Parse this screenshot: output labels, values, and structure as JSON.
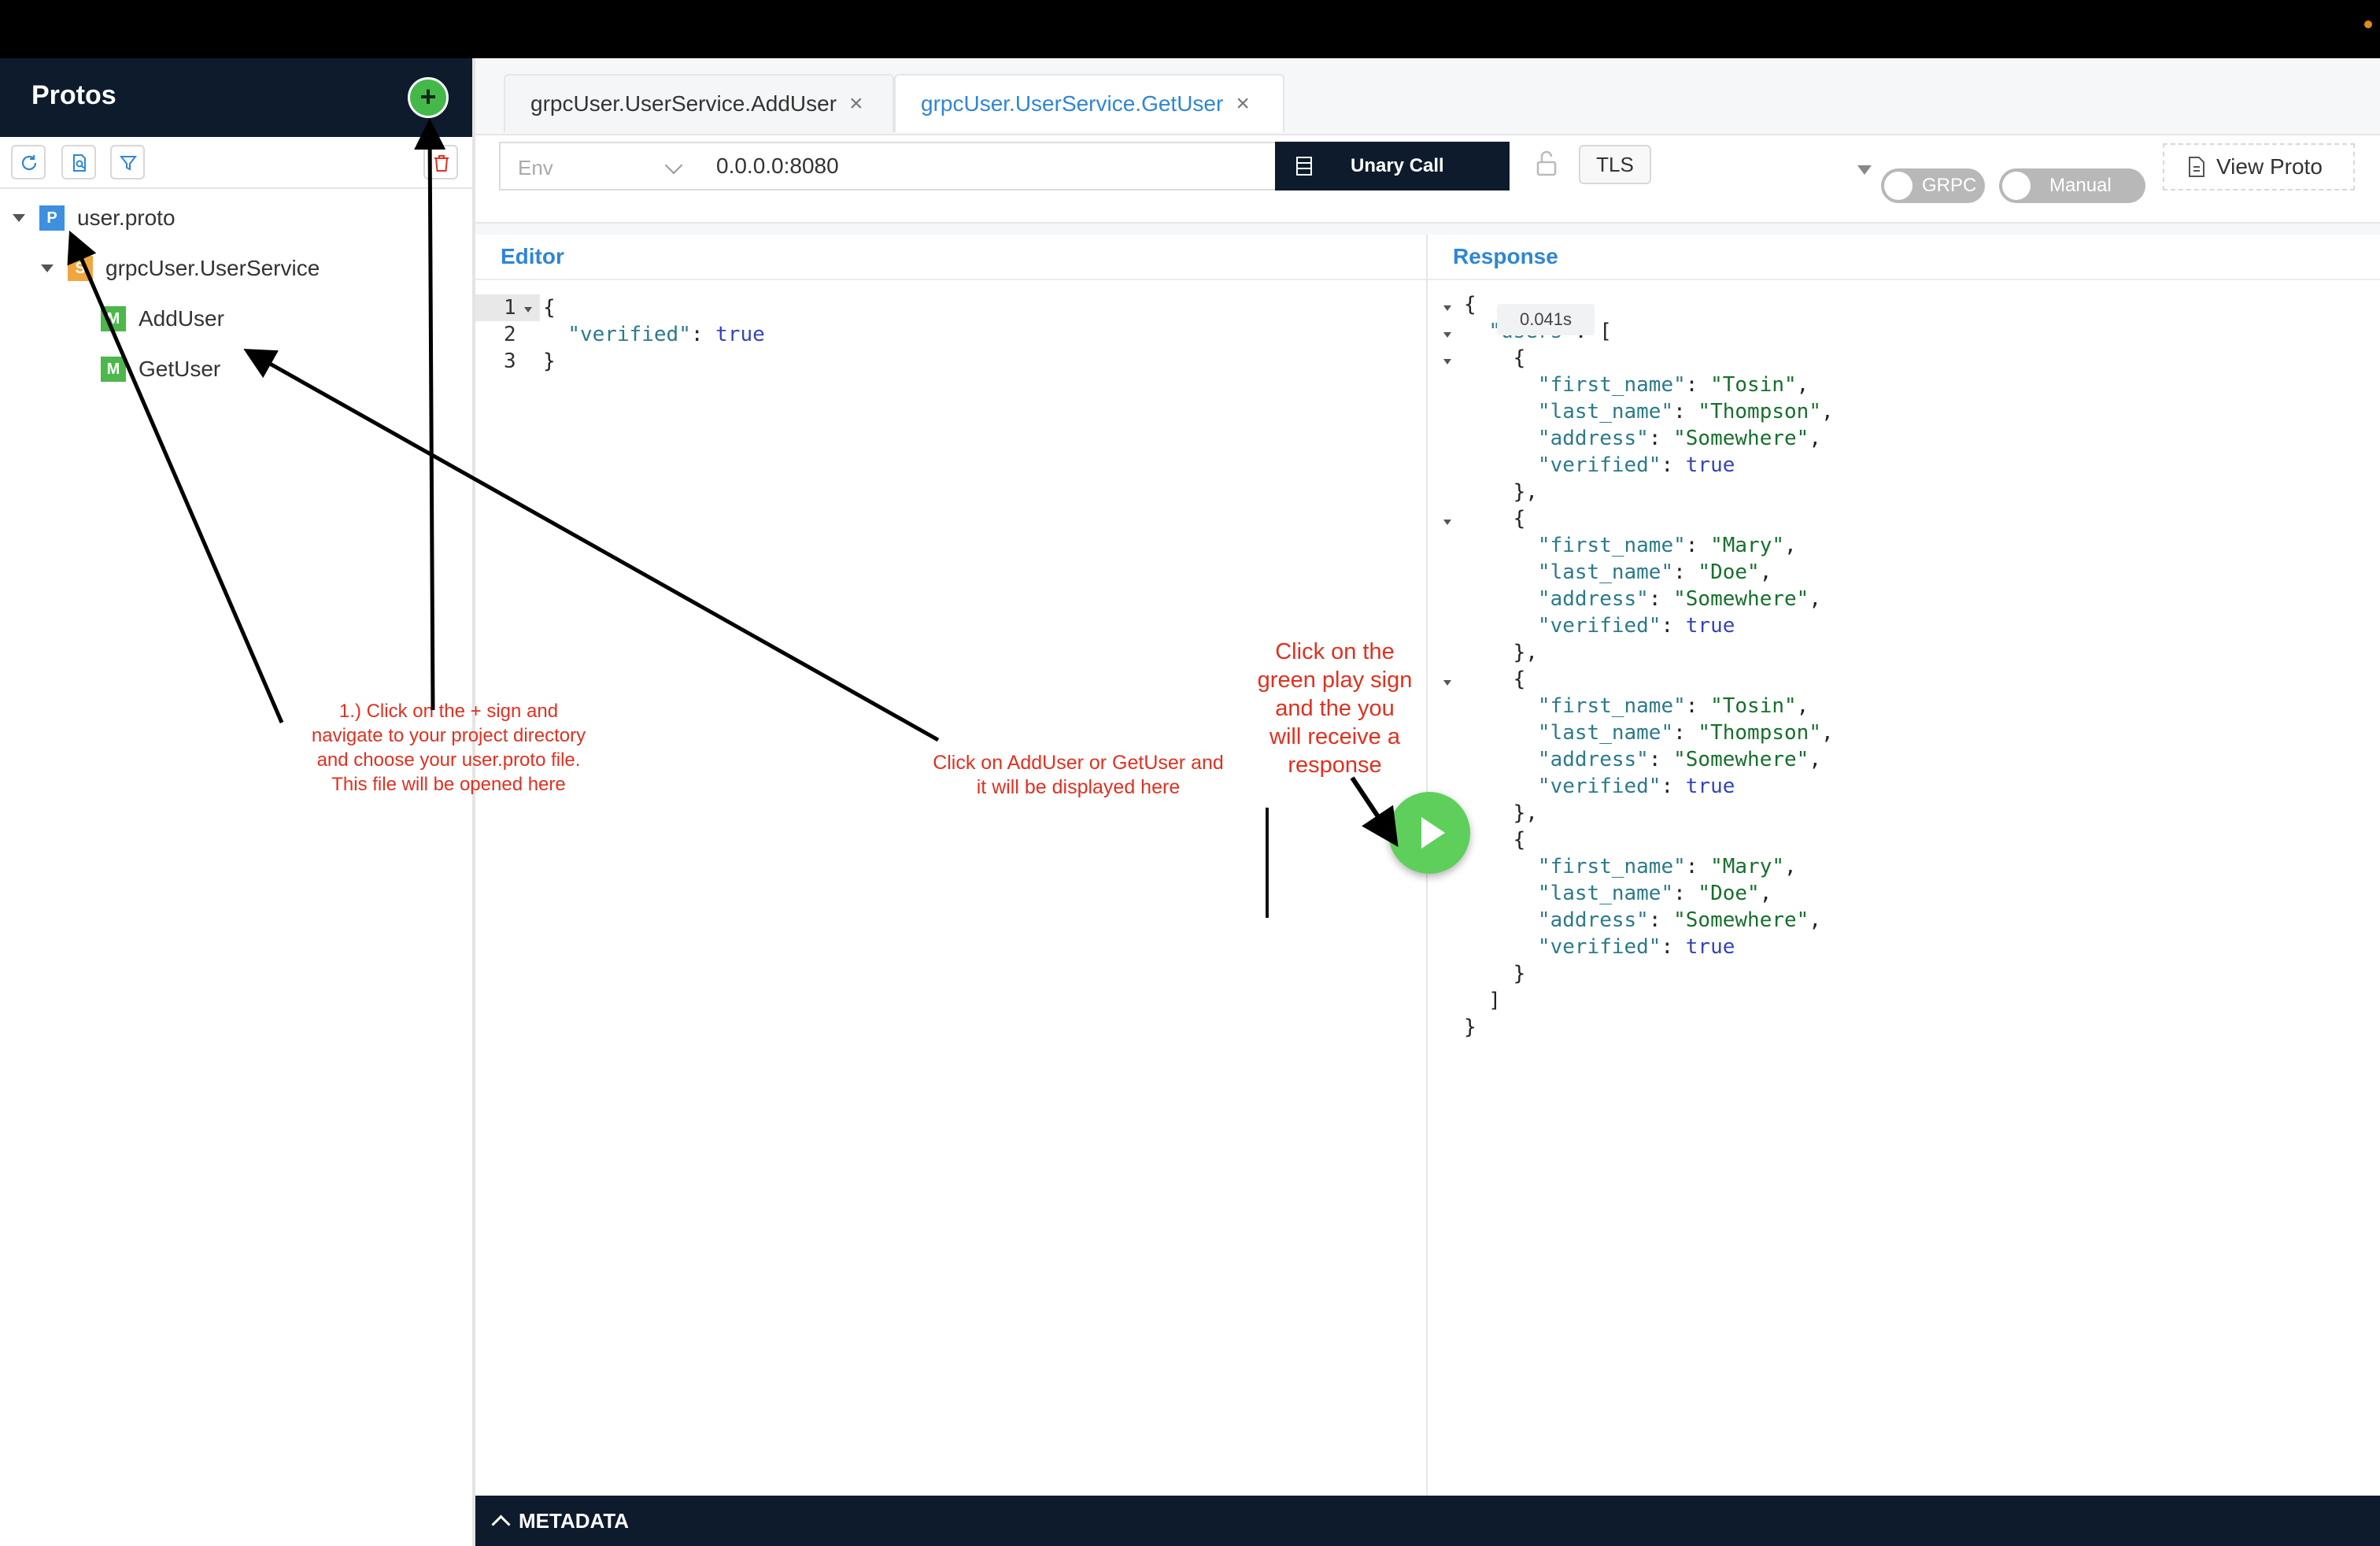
{
  "sidebar": {
    "title": "Protos",
    "tree": {
      "proto_file": {
        "badge": "P",
        "label": "user.proto"
      },
      "service": {
        "badge": "S",
        "label": "grpcUser.UserService"
      },
      "methods": [
        {
          "badge": "M",
          "label": "AddUser"
        },
        {
          "badge": "M",
          "label": "GetUser"
        }
      ]
    }
  },
  "tabs": [
    {
      "label": "grpcUser.UserService.AddUser",
      "active": false
    },
    {
      "label": "grpcUser.UserService.GetUser",
      "active": true
    }
  ],
  "toolbar": {
    "env_placeholder": "Env",
    "address": "0.0.0.0:8080",
    "call_type": "Unary Call",
    "tls_label": "TLS",
    "grpc_toggle": "GRPC",
    "manual_toggle": "Manual",
    "view_proto": "View Proto"
  },
  "editor": {
    "title": "Editor",
    "line_numbers": [
      "1",
      "2",
      "3"
    ]
  },
  "response": {
    "title": "Response",
    "time": "0.041s",
    "users": [
      {
        "first_name": "Tosin",
        "last_name": "Thompson",
        "address": "Somewhere",
        "verified": "true"
      },
      {
        "first_name": "Mary",
        "last_name": "Doe",
        "address": "Somewhere",
        "verified": "true"
      },
      {
        "first_name": "Tosin",
        "last_name": "Thompson",
        "address": "Somewhere",
        "verified": "true"
      },
      {
        "first_name": "Mary",
        "last_name": "Doe",
        "address": "Somewhere",
        "verified": "true"
      }
    ]
  },
  "metadata_label": "METADATA",
  "annotations": {
    "step1": [
      "1.) Click on the + sign and",
      "navigate to your project directory",
      "and choose your user.proto file.",
      "This file will be opened here"
    ],
    "methods": [
      "Click on AddUser or GetUser and",
      "it will be displayed here"
    ],
    "play": [
      "Click on the",
      "green play sign",
      "and the you",
      "will receive a",
      "response"
    ]
  },
  "colors": {
    "navy": "#0d1b2d",
    "accent_blue": "#2e86d6",
    "play_green": "#5fcf5c",
    "annotation_red": "#e0311f"
  }
}
